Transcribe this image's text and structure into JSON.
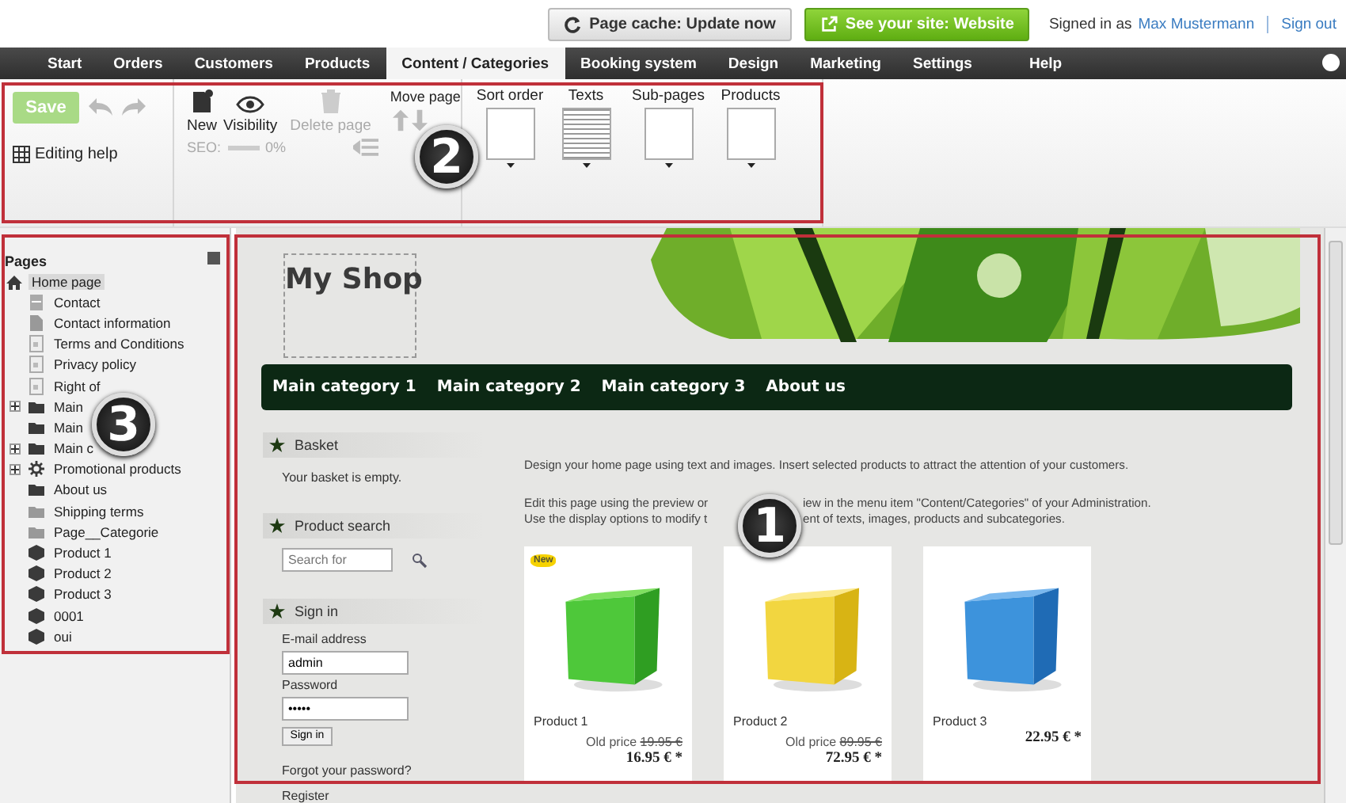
{
  "top_bar": {
    "cache_button": "Page cache: Update now",
    "site_button": "See your site: Website",
    "signed_in": "Signed in as",
    "user": "Max Mustermann",
    "sign_out": "Sign out"
  },
  "nav": [
    {
      "label": "Start",
      "selected": false
    },
    {
      "label": "Orders",
      "selected": false
    },
    {
      "label": "Customers",
      "selected": false
    },
    {
      "label": "Products",
      "selected": false
    },
    {
      "label": "Content / Categories",
      "selected": true
    },
    {
      "label": "Booking system",
      "selected": false
    },
    {
      "label": "Design",
      "selected": false
    },
    {
      "label": "Marketing",
      "selected": false
    },
    {
      "label": "Settings",
      "selected": false
    },
    {
      "label": "Help",
      "selected": false
    }
  ],
  "ribbon": {
    "save": {
      "label": "Save",
      "disabled": true
    },
    "editing_help": "Editing help",
    "new": "New",
    "visibility": "Visibility",
    "delete": {
      "label": "Delete page",
      "disabled": true
    },
    "seo_label": "SEO:",
    "seo_value": "0%",
    "move_page": "Move page",
    "views": [
      "Sort order",
      "Texts",
      "Sub-pages",
      "Products"
    ]
  },
  "pages": {
    "title": "Pages",
    "tree": [
      {
        "label": "Home page",
        "kind": "home",
        "selected": true,
        "children": [
          {
            "label": "Contact",
            "kind": "form",
            "selected": false
          },
          {
            "label": "Contact information",
            "kind": "doc",
            "selected": false
          },
          {
            "label": "Terms and Conditions",
            "kind": "text",
            "selected": false
          },
          {
            "label": "Privacy policy",
            "kind": "text",
            "selected": false
          },
          {
            "label": "Right of",
            "kind": "text",
            "selected": false
          },
          {
            "label": "Main",
            "kind": "folder",
            "selected": false,
            "expanded": false
          },
          {
            "label": "Main",
            "kind": "folder",
            "selected": false
          },
          {
            "label": "Main c",
            "kind": "folder",
            "selected": false,
            "expanded": false
          },
          {
            "label": "Promotional products",
            "kind": "promo",
            "selected": false,
            "expanded": false
          },
          {
            "label": "About us",
            "kind": "folder",
            "selected": false
          },
          {
            "label": "Shipping terms",
            "kind": "hidden-folder",
            "selected": false
          },
          {
            "label": "Page__Categorie",
            "kind": "hidden-folder",
            "selected": false
          },
          {
            "label": "Product 1",
            "kind": "product",
            "selected": false
          },
          {
            "label": "Product 2",
            "kind": "product",
            "selected": false
          },
          {
            "label": "Product 3",
            "kind": "product",
            "selected": false
          },
          {
            "label": "0001",
            "kind": "product",
            "selected": false
          },
          {
            "label": "oui",
            "kind": "product",
            "selected": false
          }
        ]
      }
    ]
  },
  "preview": {
    "shop_title": "My Shop",
    "categories": [
      "Main category 1",
      "Main category 2",
      "Main category 3",
      "About us"
    ],
    "basket": {
      "title": "Basket",
      "text": "Your basket is empty."
    },
    "search": {
      "title": "Product search",
      "placeholder": "Search for"
    },
    "sign_in": {
      "title": "Sign in",
      "email_label": "E-mail address",
      "email": "admin",
      "password_label": "Password",
      "password": "•••••",
      "button": "Sign in",
      "forgot": "Forgot your password?",
      "register": "Register"
    },
    "intro": "Design your home page using text and images. Insert selected products to attract the attention of your customers.",
    "edit_lines": [
      [
        "Edit this page using the preview or",
        "iew in the menu item \"Content/Categories\" of your Administration."
      ],
      [
        "Use the display options to modify t",
        "ent of texts, images, products and subcategories."
      ]
    ],
    "products": [
      {
        "name": "Product 1",
        "badge": "New",
        "old_label": "Old price",
        "old_price": "19.95 €",
        "price": "16.95 € *"
      },
      {
        "name": "Product 2",
        "old_label": "Old price",
        "old_price": "89.95 €",
        "price": "72.95 € *"
      },
      {
        "name": "Product 3",
        "price": "22.95 € *"
      }
    ]
  },
  "callouts": [
    "1",
    "2",
    "3"
  ]
}
